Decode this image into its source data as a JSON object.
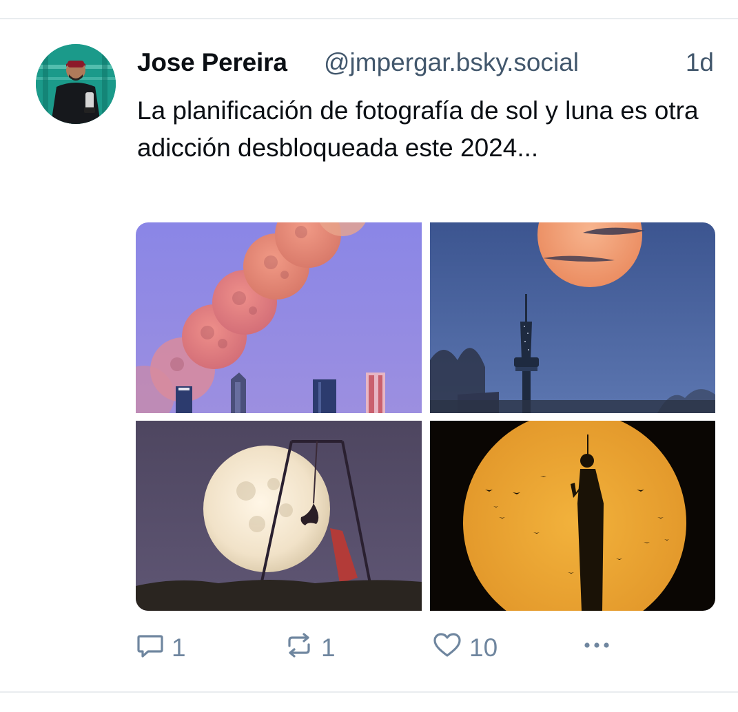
{
  "post": {
    "author": {
      "display_name": "Jose Pereira",
      "handle": "@jmpergar.bsky.social"
    },
    "timestamp": "1d",
    "text": "La planificación de fotografía de sol y luna es otra adicción desbloqueada este 2024..."
  },
  "media": [
    {
      "subject": "moonrise-sequence-over-skyscrapers"
    },
    {
      "subject": "full-moon-over-tv-tower"
    },
    {
      "subject": "aerial-acrobat-in-front-of-full-moon"
    },
    {
      "subject": "statue-silhouette-with-birds-against-sun"
    }
  ],
  "actions": {
    "replies": "1",
    "reposts": "1",
    "likes": "10"
  },
  "icons": {
    "reply": "reply-icon",
    "repost": "repost-icon",
    "like": "heart-icon",
    "more": "more-icon"
  },
  "colors": {
    "muted": "#6f869f",
    "handle": "#42576c",
    "text": "#0b0f14"
  }
}
